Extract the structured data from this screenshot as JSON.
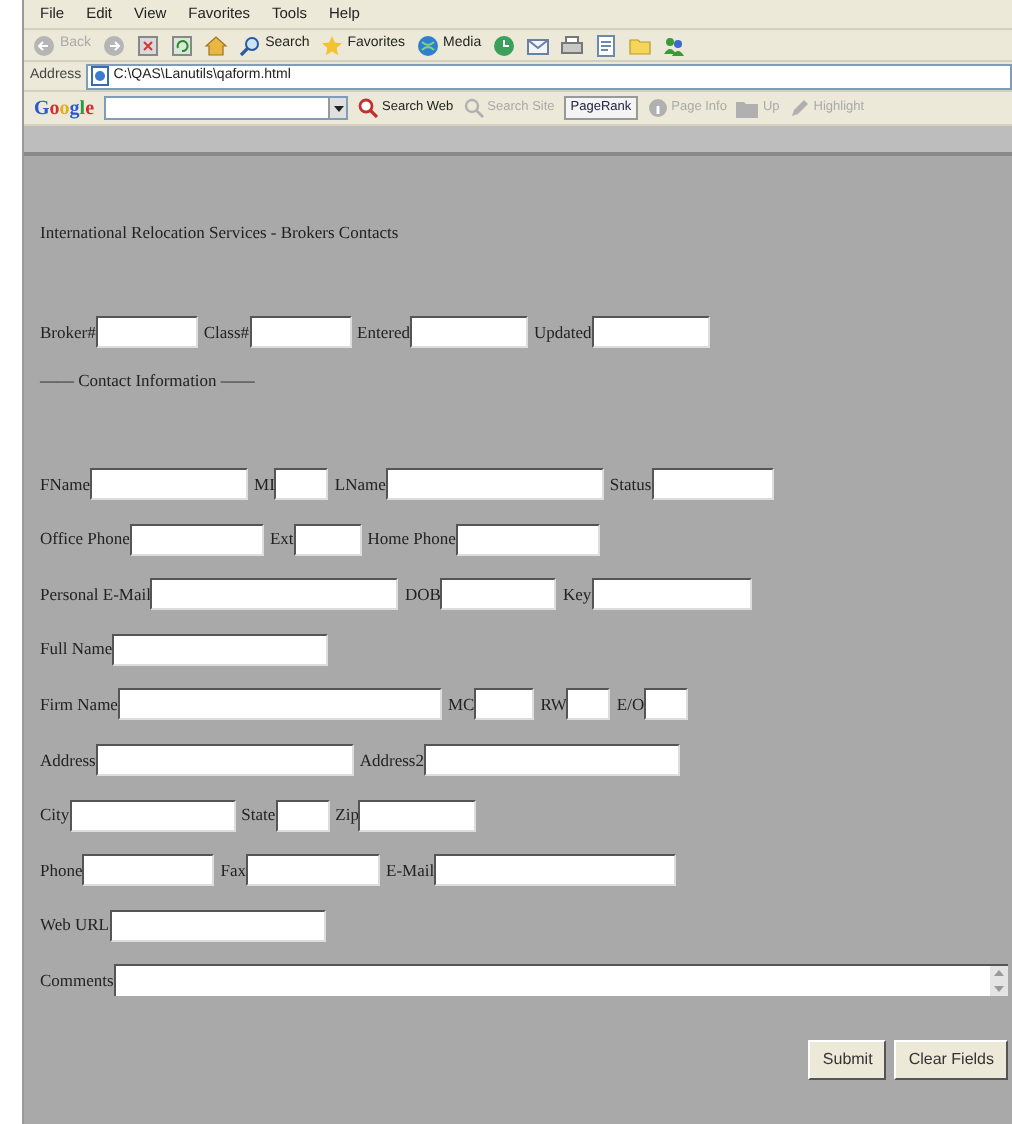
{
  "menu": [
    "File",
    "Edit",
    "View",
    "Favorites",
    "Tools",
    "Help"
  ],
  "toolbar": [
    {
      "kind": "back",
      "label": "Back",
      "disabled": true
    },
    {
      "kind": "forward",
      "disabled": true
    },
    {
      "kind": "stop",
      "disabled": false
    },
    {
      "kind": "refresh",
      "disabled": false
    },
    {
      "kind": "home",
      "disabled": false
    },
    {
      "kind": "search",
      "label": "Search",
      "disabled": false
    },
    {
      "kind": "favorites",
      "label": "Favorites",
      "disabled": false
    },
    {
      "kind": "media",
      "label": "Media",
      "disabled": false
    },
    {
      "kind": "history",
      "disabled": false
    },
    {
      "kind": "mail",
      "disabled": false
    },
    {
      "kind": "print",
      "disabled": false
    },
    {
      "kind": "edit",
      "disabled": false
    },
    {
      "kind": "folder",
      "disabled": false
    },
    {
      "kind": "messenger",
      "disabled": false
    }
  ],
  "address_bar": {
    "label": "Address",
    "value": "C:\\QAS\\Lanutils\\qaform.html"
  },
  "google_bar": {
    "logo": "Google",
    "buttons": [
      {
        "kind": "search",
        "label": "Search Web",
        "disabled": false
      },
      {
        "kind": "site",
        "label": "Search Site",
        "disabled": true
      },
      {
        "kind": "pagerank",
        "label": "PageRank",
        "disabled": false
      },
      {
        "kind": "info",
        "label": "Page Info",
        "disabled": true
      },
      {
        "kind": "up",
        "label": "Up",
        "disabled": true
      },
      {
        "kind": "highlight",
        "label": "Highlight",
        "disabled": true
      }
    ]
  },
  "form": {
    "title": "International Relocation Services - Brokers Contacts",
    "header_fields": [
      {
        "label": "Broker#"
      },
      {
        "label": "Class#"
      },
      {
        "label": "Entered"
      },
      {
        "label": "Updated"
      }
    ],
    "section_label": "—— Contact Information ——",
    "rows": [
      [
        {
          "label": "FName"
        },
        {
          "label": "MI"
        },
        {
          "label": "LName"
        },
        {
          "label": "Status"
        }
      ],
      [
        {
          "label": "Office Phone"
        },
        {
          "label": "Ext"
        },
        {
          "label": "Home Phone"
        }
      ],
      [
        {
          "label": "Personal E-Mail"
        },
        {
          "label": "DOB"
        },
        {
          "label": "Key"
        }
      ],
      [
        {
          "label": "Full Name"
        }
      ],
      [
        {
          "label": "Firm Name"
        },
        {
          "label": "MC"
        },
        {
          "label": "RW"
        },
        {
          "label": "E/O"
        }
      ],
      [
        {
          "label": "Address"
        },
        {
          "label": "Address2"
        }
      ],
      [
        {
          "label": "City"
        },
        {
          "label": "State"
        },
        {
          "label": "Zip"
        }
      ],
      [
        {
          "label": "Phone"
        },
        {
          "label": "Fax"
        },
        {
          "label": "E-Mail"
        }
      ],
      [
        {
          "label": "Web URL"
        }
      ]
    ],
    "comments": {
      "label": "Comments"
    },
    "buttons": [
      {
        "label": "Submit"
      },
      {
        "label": "Clear Fields"
      }
    ]
  }
}
